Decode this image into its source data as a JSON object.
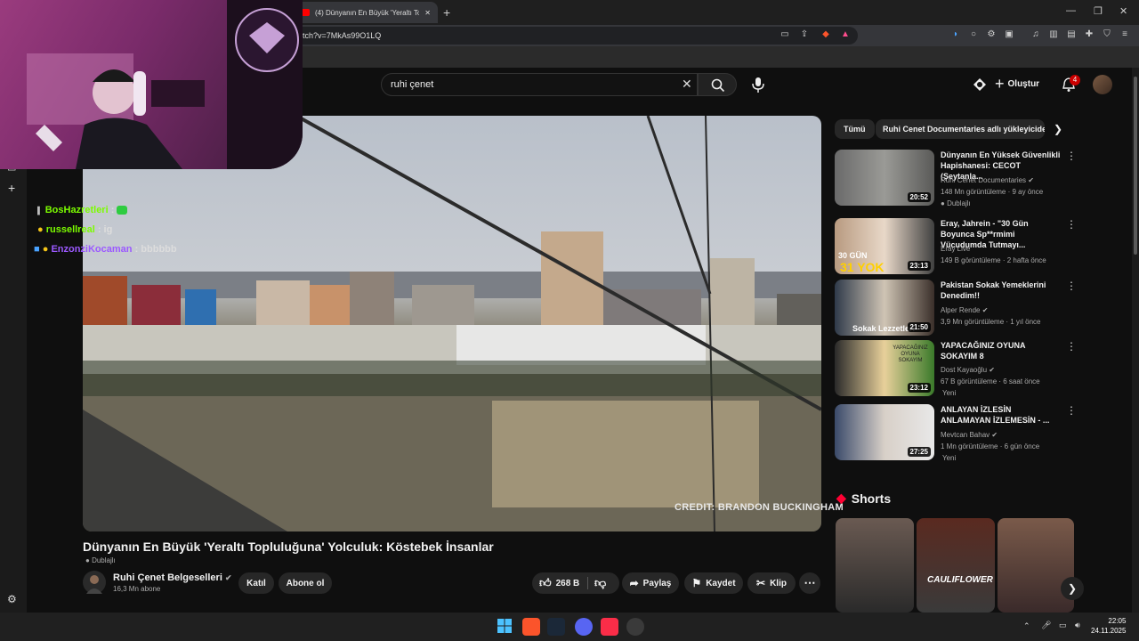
{
  "browser": {
    "tab_title": "(4) Dünyanın En Büyük 'Yeraltı To",
    "url": "tch?v=7MkAs99O1LQ"
  },
  "header": {
    "search_value": "ruhi çenet",
    "create_label": "Oluştur",
    "notification_count": "4"
  },
  "chat": [
    {
      "user": "BosHazretleri",
      "text": ":",
      "color": "#7cfc00"
    },
    {
      "user": "russellreal",
      "text": ": ig",
      "color": "#7cfc00"
    },
    {
      "user": "EnzonziKocaman",
      "text": ": bbbbbb",
      "color": "#9b59ff"
    }
  ],
  "video": {
    "credit": "CREDIT: BRANDON BUCKINGHAM",
    "title": "Dünyanın En Büyük 'Yeraltı Topluluğuna' Yolculuk: Köstebek İnsanlar",
    "dub_label": "Dublajlı"
  },
  "channel": {
    "name": "Ruhi Çenet Belgeselleri",
    "subs": "16,3 Mn abone",
    "join_label": "Katıl",
    "subscribe_label": "Abone ol"
  },
  "actions": {
    "likes": "268 B",
    "share": "Paylaş",
    "save": "Kaydet",
    "clip": "Klip"
  },
  "chips": {
    "all": "Tümü",
    "ruhi": "Ruhi Cenet Documentaries adlı yükleyiciden"
  },
  "recommendations": [
    {
      "title": "Dünyanın En Yüksek Güvenlikli Hapishanesi: CECOT (Şeytanla...",
      "channel": "Ruhi Cenet Documentaries",
      "meta": "148 Mn görüntüleme · 9 ay önce",
      "tag": "Dublajlı",
      "duration": "20:52"
    },
    {
      "title": "Eray, Jahrein - \"30 Gün Boyunca Sp**rmimi Vücudumda Tutmayı...",
      "channel": "Eray Live",
      "meta": "149 B görüntüleme · 2 hafta önce",
      "tag": "",
      "duration": "23:13"
    },
    {
      "title": "Pakistan Sokak Yemeklerini Denedim!!",
      "channel": "Alper Rende",
      "meta": "3,9 Mn görüntüleme · 1 yıl önce",
      "tag": "",
      "duration": "21:50"
    },
    {
      "title": "YAPACAĞINIZ OYUNA SOKAYIM 8",
      "channel": "Dost Kayaoğlu",
      "meta": "67 B görüntüleme · 6 saat önce",
      "tag": "Yeni",
      "duration": "23:12"
    },
    {
      "title": "ANLAYAN İZLESİN ANLAMAYAN İZLEMESİN - ...",
      "channel": "Mevtcan Bahav",
      "meta": "1 Mn görüntüleme · 6 gün önce",
      "tag": "Yeni",
      "duration": "27:25"
    }
  ],
  "thumb_text": {
    "r1": "30 GÜN",
    "r1b": "31 YOK",
    "r2": "Sokak Lezzetleri",
    "r3": "YAPACAĞINIZ OYUNA SOKAYIM",
    "short2": "CAULIFLOWER"
  },
  "shorts": {
    "header": "Shorts"
  },
  "taskbar": {
    "time": "22:05",
    "date": "24.11.2025"
  }
}
